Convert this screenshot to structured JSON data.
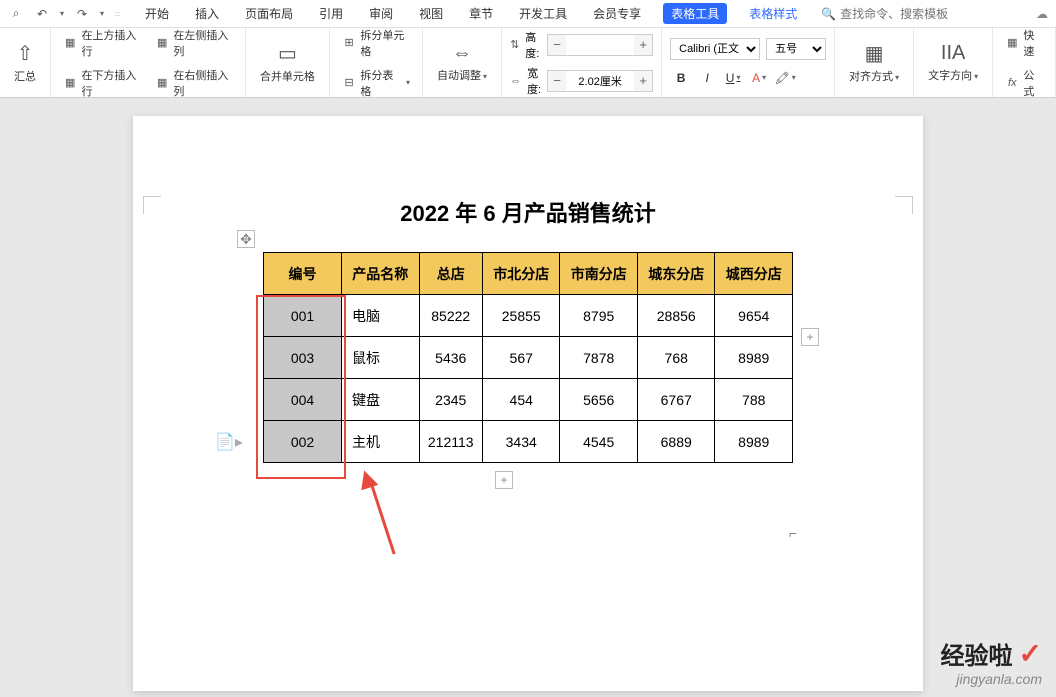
{
  "menu": {
    "tabs": [
      "开始",
      "插入",
      "页面布局",
      "引用",
      "审阅",
      "视图",
      "章节",
      "开发工具",
      "会员专享"
    ],
    "active_tool": "表格工具",
    "context_tab": "表格样式",
    "search_placeholder": "查找命令、搜索模板"
  },
  "ribbon": {
    "summary": "汇总",
    "insert_top": "在上方插入行",
    "insert_bottom": "在下方插入行",
    "insert_left": "在左侧插入列",
    "insert_right": "在右侧插入列",
    "merge_cells": "合并单元格",
    "split_cells": "拆分单元格",
    "split_table": "拆分表格",
    "auto_fit": "自动调整",
    "height": "高度:",
    "width": "宽度:",
    "height_val": "",
    "width_val": "2.02厘米",
    "font_name": "Calibri (正文)",
    "font_size": "五号",
    "align": "对齐方式",
    "text_dir": "文字方向",
    "quick": "快速",
    "formula": "公式"
  },
  "doc": {
    "title": "2022 年 6 月产品销售统计"
  },
  "table": {
    "headers": [
      "编号",
      "产品名称",
      "总店",
      "市北分店",
      "市南分店",
      "城东分店",
      "城西分店"
    ],
    "rows": [
      [
        "001",
        "电脑",
        "85222",
        "25855",
        "8795",
        "28856",
        "9654"
      ],
      [
        "003",
        "鼠标",
        "5436",
        "567",
        "7878",
        "768",
        "8989"
      ],
      [
        "004",
        "键盘",
        "2345",
        "454",
        "5656",
        "6767",
        "788"
      ],
      [
        "002",
        "主机",
        "212113",
        "3434",
        "4545",
        "6889",
        "8989"
      ]
    ]
  },
  "watermark": {
    "main": "经验啦",
    "sub": "jingyanla.com"
  }
}
